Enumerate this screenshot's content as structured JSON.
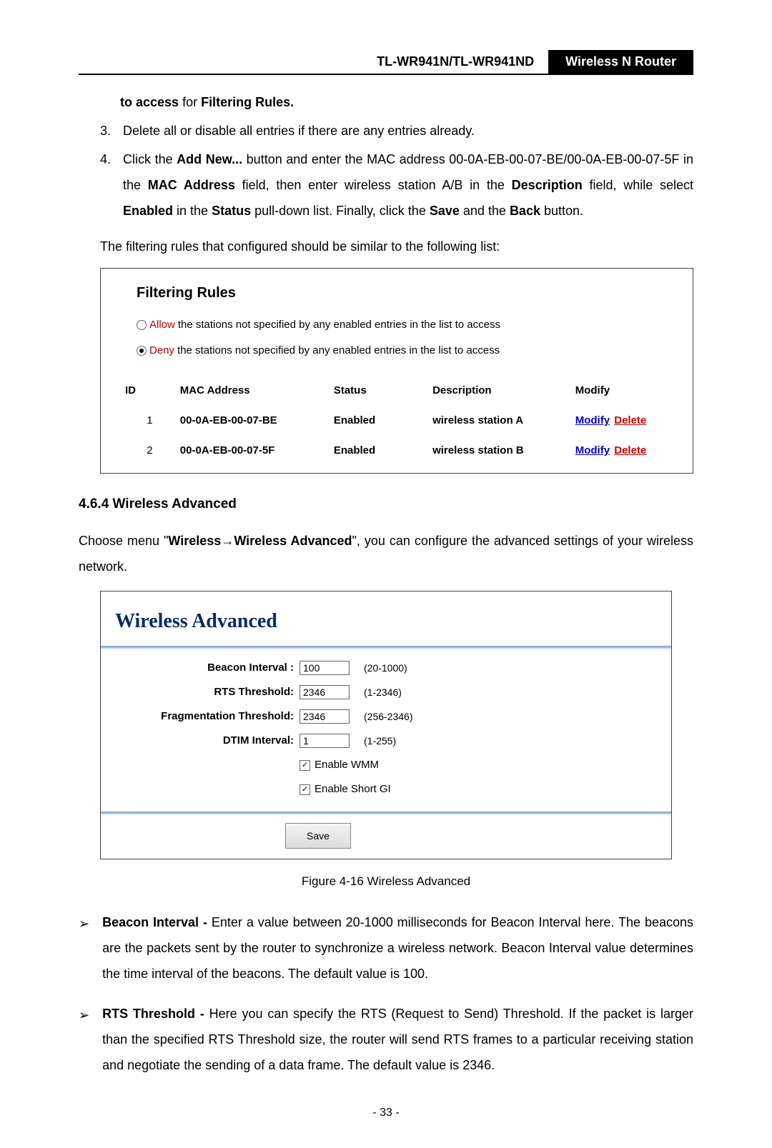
{
  "header": {
    "model": "TL-WR941N/TL-WR941ND",
    "title": "Wireless  N  Router"
  },
  "intro": {
    "continued_bold": "to access",
    "continued_text": " for ",
    "continued_bold2": "Filtering Rules."
  },
  "step3_num": "3.",
  "step3_text": "Delete all or disable all entries if there are any entries already.",
  "step4_num": "4.",
  "step4": {
    "p1a": "Click the ",
    "p1b": "Add New...",
    "p1c": " button and enter the MAC address 00-0A-EB-00-07-BE/00-0A-EB-00-07-5F in the ",
    "p1d": "MAC Address",
    "p1e": " field, then enter wireless station A/B in the ",
    "p1f": "Description",
    "p1g": " field, while select ",
    "p1h": "Enabled",
    "p1i": " in the ",
    "p1j": "Status",
    "p1k": " pull-down list. Finally, click the ",
    "p1l": "Save",
    "p1m": " and the ",
    "p1n": "Back",
    "p1o": " button."
  },
  "rules_intro": "The filtering rules that configured should be similar to the following list:",
  "rules_box": {
    "title": "Filtering Rules",
    "allow_label": "Allow",
    "allow_text": " the stations not specified by any enabled entries in the list to access",
    "deny_label": "Deny",
    "deny_text": " the stations not specified by any enabled entries in the list to access",
    "headers": {
      "id": "ID",
      "mac": "MAC Address",
      "status": "Status",
      "desc": "Description",
      "modify": "Modify"
    },
    "rows": [
      {
        "id": "1",
        "mac": "00-0A-EB-00-07-BE",
        "status": "Enabled",
        "desc": "wireless station A",
        "mod": "Modify",
        "del": "Delete"
      },
      {
        "id": "2",
        "mac": "00-0A-EB-00-07-5F",
        "status": "Enabled",
        "desc": "wireless station B",
        "mod": "Modify",
        "del": "Delete"
      }
    ]
  },
  "section": {
    "num_title": "4.6.4  Wireless Advanced",
    "p1a": "Choose menu \"",
    "p1b": "Wireless",
    "p1arrow": "→",
    "p1c": "Wireless Advanced",
    "p1d": "\", you can configure the advanced settings of your wireless network."
  },
  "panel": {
    "title": "Wireless Advanced",
    "beacon_label": "Beacon Interval :",
    "beacon_value": "100",
    "beacon_range": "(20-1000)",
    "rts_label": "RTS Threshold:",
    "rts_value": "2346",
    "rts_range": "(1-2346)",
    "frag_label": "Fragmentation Threshold:",
    "frag_value": "2346",
    "frag_range": "(256-2346)",
    "dtim_label": "DTIM Interval:",
    "dtim_value": "1",
    "dtim_range": "(1-255)",
    "wmm_label": "Enable WMM",
    "shortgi_label": "Enable Short GI",
    "save_label": "Save"
  },
  "figure_caption": "Figure 4-16 Wireless Advanced",
  "bullets": {
    "beacon_title": "Beacon Interval - ",
    "beacon_text": "Enter a value between 20-1000 milliseconds for Beacon Interval here. The beacons are the packets sent by the router to synchronize a wireless network. Beacon Interval value determines the time interval of the beacons. The default value is 100.",
    "rts_title": "RTS Threshold - ",
    "rts_text": "Here you can specify the RTS (Request to Send) Threshold. If the packet is larger than the specified RTS Threshold size, the router will send RTS frames to a particular receiving station and negotiate the sending of a data frame. The default value is 2346."
  },
  "page_number": "- 33 -"
}
